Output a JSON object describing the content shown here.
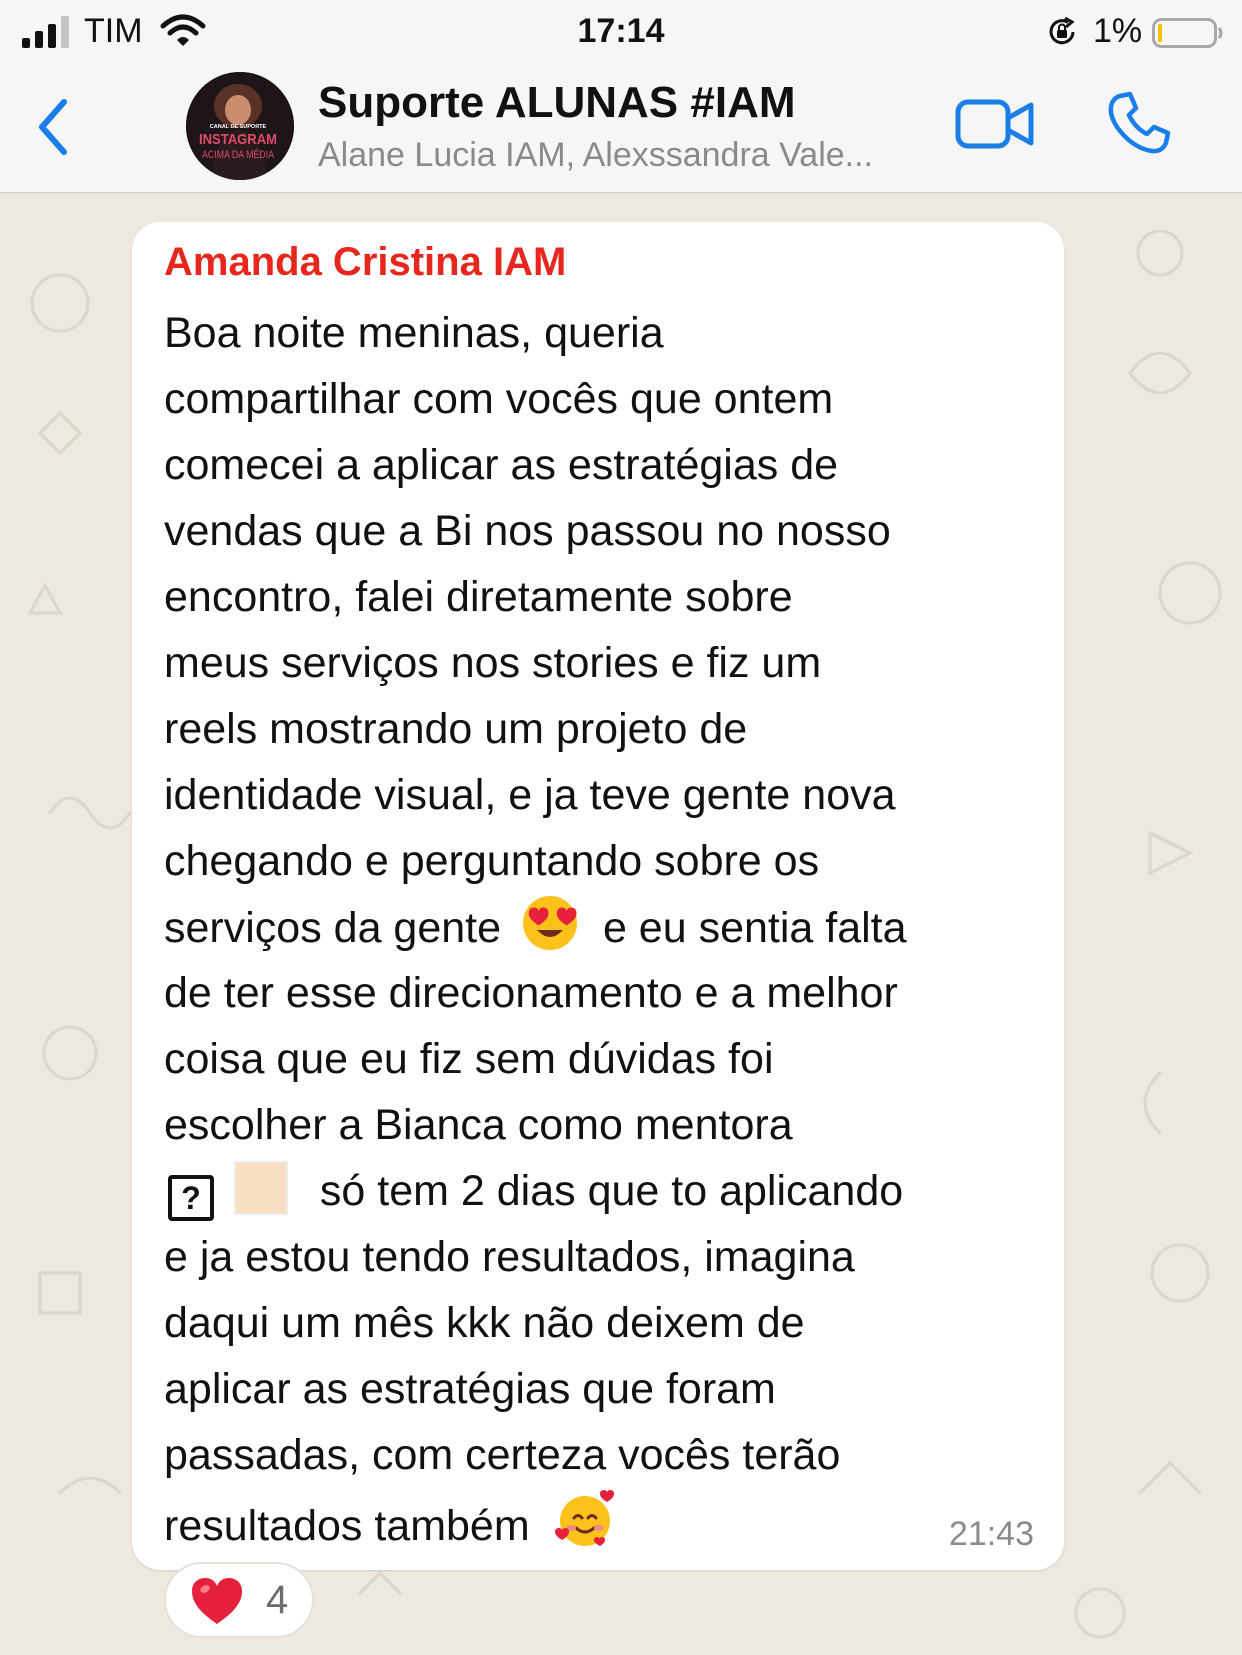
{
  "status_bar": {
    "carrier": "TIM",
    "time": "17:14",
    "battery_percent": "1%"
  },
  "header": {
    "title": "Suporte ALUNAS #IAM",
    "subtitle": "Alane Lucia IAM, Alexssandra Vale...",
    "avatar_text": {
      "top": "CANAL DE SUPORTE",
      "main": "INSTAGRAM",
      "bottom": "ACIMA DA MÉDIA"
    },
    "icons": {
      "back": "chevron-left-icon",
      "video": "video-camera-icon",
      "call": "phone-icon"
    }
  },
  "message": {
    "sender": "Amanda Cristina IAM",
    "lines": [
      "Boa noite meninas, queria",
      "compartilhar com vocês que ontem",
      "comecei a aplicar as estratégias de",
      "vendas que a Bi nos passou no nosso",
      "encontro, falei diretamente sobre",
      "meus serviços nos stories e fiz um",
      "reels mostrando um projeto de",
      "identidade visual, e ja teve gente nova",
      "chegando e perguntando sobre os",
      "serviços da gente",
      "e eu sentia falta",
      "de ter esse direcionamento e a melhor",
      "coisa que eu fiz sem dúvidas foi",
      "escolher a Bianca como mentora",
      "?",
      "só tem 2 dias que to aplicando",
      "e ja estou tendo resultados, imagina",
      "daqui um mês kkk não deixem de",
      "aplicar as estratégias que foram",
      "passadas, com certeza vocês terão",
      "resultados também"
    ],
    "time": "21:43"
  },
  "reaction": {
    "emoji": "heart-icon",
    "count": "4"
  },
  "colors": {
    "sender": "#e7271d",
    "accent_blue": "#1a7ee8",
    "chat_background": "#ede8e0",
    "bubble": "#ffffff"
  }
}
